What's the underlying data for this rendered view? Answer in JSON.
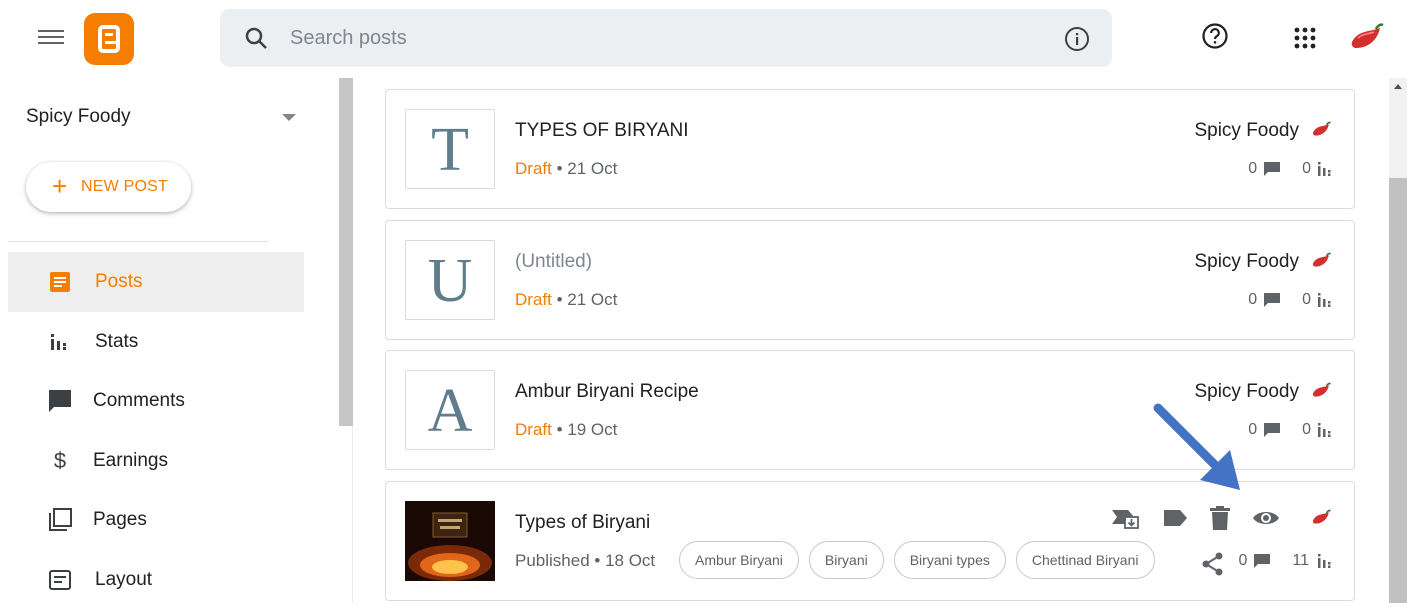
{
  "header": {
    "search_placeholder": "Search posts",
    "icons": [
      "menu-icon",
      "blogger-logo",
      "search-icon",
      "info-icon",
      "help-icon",
      "apps-grid-icon",
      "chili-avatar"
    ]
  },
  "sidebar": {
    "blog_name": "Spicy Foody",
    "new_post_label": "NEW POST",
    "items": [
      {
        "label": "Posts",
        "icon": "posts-icon",
        "active": true
      },
      {
        "label": "Stats",
        "icon": "stats-icon"
      },
      {
        "label": "Comments",
        "icon": "comments-icon"
      },
      {
        "label": "Earnings",
        "icon": "dollar-icon"
      },
      {
        "label": "Pages",
        "icon": "pages-icon"
      },
      {
        "label": "Layout",
        "icon": "layout-icon"
      }
    ]
  },
  "posts": [
    {
      "thumb": "T",
      "title": "TYPES OF BIRYANI",
      "status": "Draft",
      "date": "• 21 Oct",
      "blog": "Spicy Foody",
      "comments": "0",
      "views": "0"
    },
    {
      "thumb": "U",
      "title": "(Untitled)",
      "status": "Draft",
      "date": "• 21 Oct",
      "blog": "Spicy Foody",
      "comments": "0",
      "views": "0"
    },
    {
      "thumb": "A",
      "title": "Ambur Biryani Recipe",
      "status": "Draft",
      "date": "• 19 Oct",
      "blog": "Spicy Foody",
      "comments": "0",
      "views": "0"
    },
    {
      "title": "Types of Biryani",
      "status": "Published • 18 Oct",
      "labels": [
        "Ambur Biryani",
        "Biryani",
        "Biryani types",
        "Chettinad Biryani"
      ],
      "comments": "0",
      "views": "11",
      "actions": [
        "revert-to-draft-icon",
        "label-icon",
        "delete-icon",
        "view-icon",
        "chili-avatar"
      ]
    }
  ],
  "colors": {
    "accent": "#f57d00",
    "annotation_arrow": "#4472c4"
  }
}
